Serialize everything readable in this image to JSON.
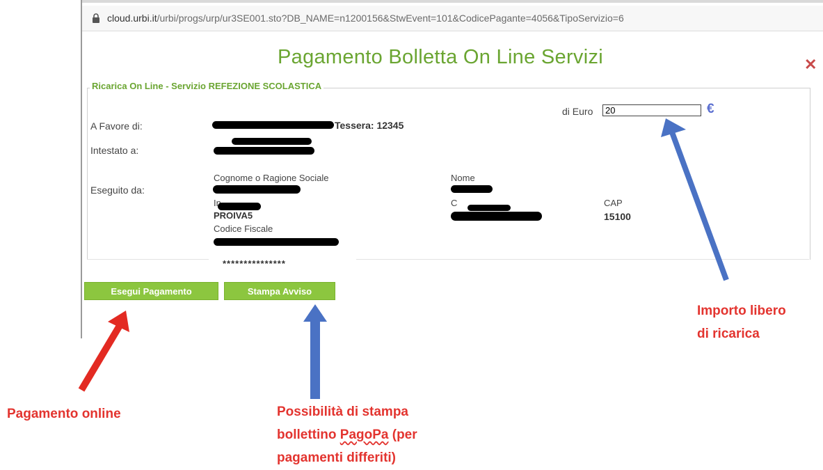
{
  "browser": {
    "url_host": "cloud.urbi.it",
    "url_path": "/urbi/progs/urp/ur3SE001.sto?DB_NAME=n1200156&StwEvent=101&CodicePagante=4056&TipoServizio=6"
  },
  "page": {
    "title": "Pagamento Bolletta On Line Servizi",
    "close_label": "✕",
    "legend": "Ricarica On Line - Servizio REFEZIONE SCOLASTICA"
  },
  "form": {
    "di_euro_label": "di Euro",
    "amount_value": "20",
    "euro_symbol": "€",
    "a_favore_label": "A Favore di:",
    "tessera": "Tessera: 12345",
    "intestato_label": "Intestato a:",
    "eseguito_label": "Eseguito da:",
    "cognome_label": "Cognome o Ragione Sociale",
    "nome_label": "Nome",
    "in_label": "In",
    "c_label": "C",
    "cap_label": "CAP",
    "provincia_value": "PROIVA5",
    "cap_value": "15100",
    "codice_fiscale_label": "Codice Fiscale",
    "masked": "***************"
  },
  "buttons": {
    "esegui": "Esegui Pagamento",
    "stampa": "Stampa Avviso"
  },
  "annotations": {
    "importo_line1": "Importo libero",
    "importo_line2": "di ricarica",
    "pagamento_online": "Pagamento online",
    "stampa_line1": "Possibilità di stampa",
    "stampa_line2_a": "bollettino ",
    "stampa_line2_b": "PagoPa",
    "stampa_line2_c": " (per",
    "stampa_line3": "pagamenti differiti)"
  },
  "colors": {
    "brand_green": "#6aa531",
    "button_green": "#8cc63f",
    "annotation_red": "#e3342f",
    "arrow_blue": "#4a72c4",
    "arrow_red": "#e32a22"
  },
  "icons": [
    "lock-icon",
    "close-icon",
    "euro-icon",
    "arrow-up-icon"
  ]
}
